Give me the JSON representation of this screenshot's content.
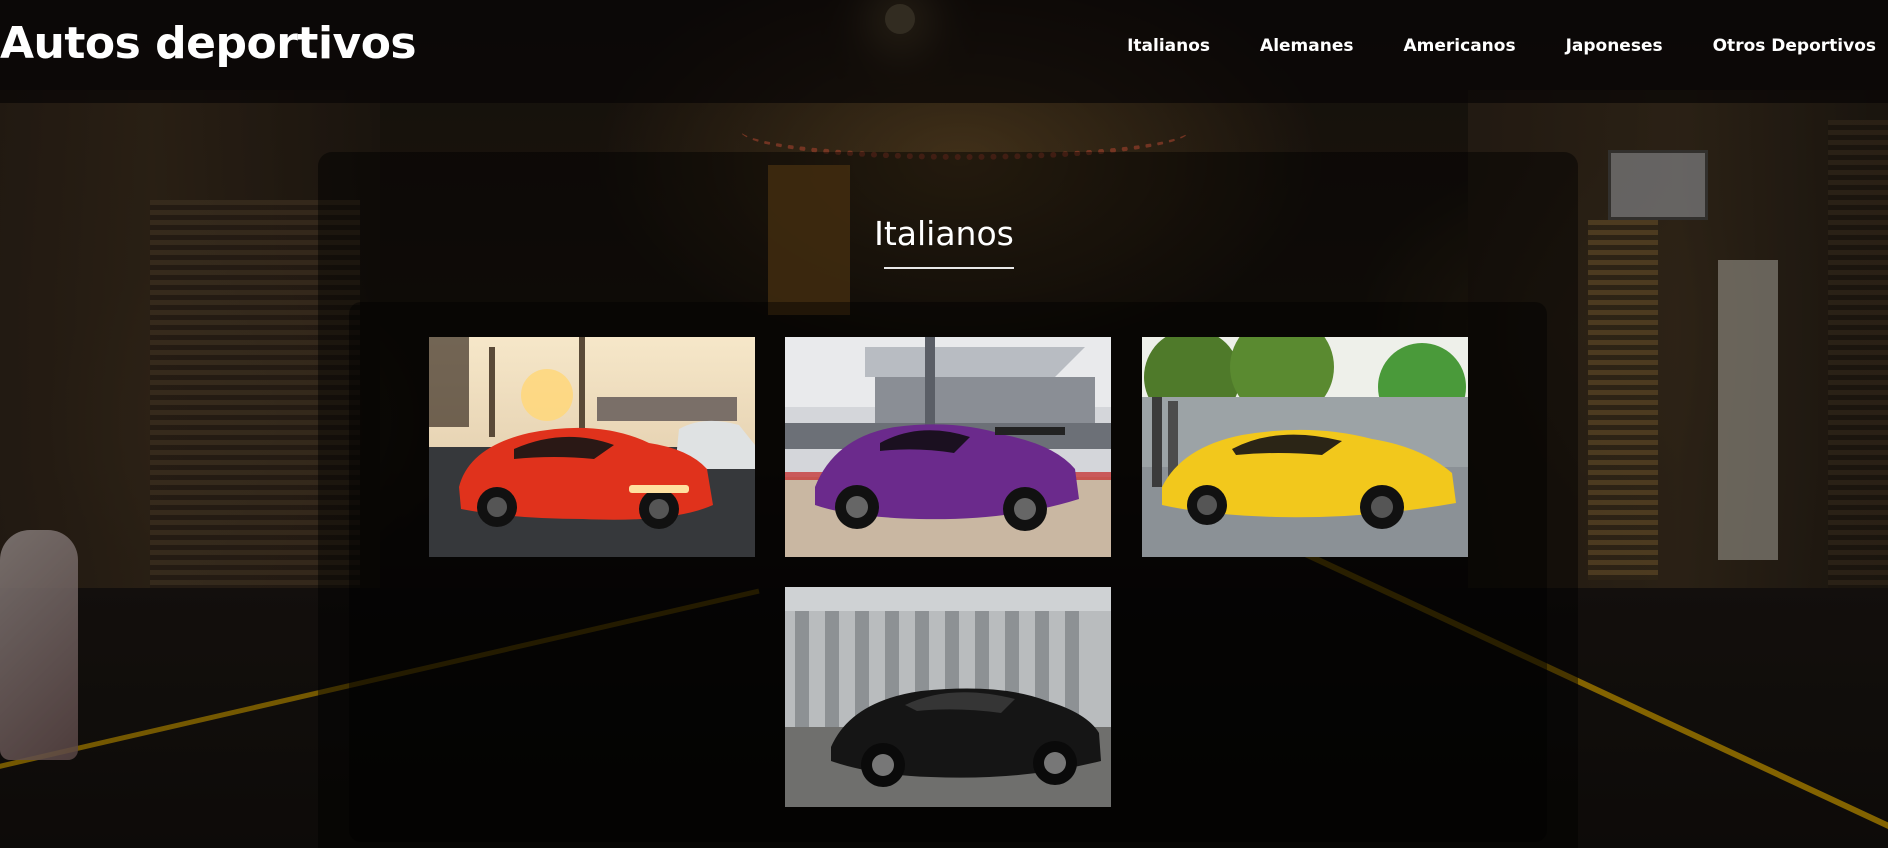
{
  "header": {
    "site_title": "Autos deportivos",
    "nav": [
      {
        "label": "Italianos"
      },
      {
        "label": "Alemanes"
      },
      {
        "label": "Americanos"
      },
      {
        "label": "Japoneses"
      },
      {
        "label": "Otros Deportivos"
      }
    ]
  },
  "section": {
    "title": "Italianos"
  },
  "gallery": {
    "cars": [
      {
        "color": "#e0321c",
        "scene": "street-sunset"
      },
      {
        "color": "#6b2a8c",
        "scene": "race-track"
      },
      {
        "color": "#f2c81c",
        "scene": "parking-trees"
      },
      {
        "color": "#151515",
        "scene": "building-wall"
      }
    ]
  }
}
